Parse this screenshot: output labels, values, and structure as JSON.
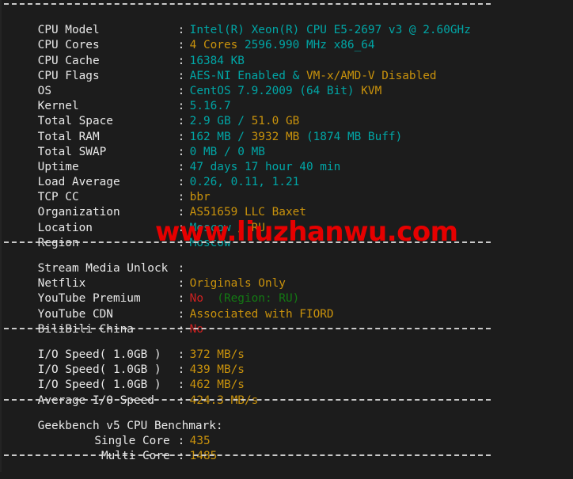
{
  "terminal": {
    "background_color": "#1c1c1c",
    "label_color": "#e8e8e8",
    "cyan_color": "#00a6a6",
    "orange_color": "#c9920c",
    "red_color": "#cf2020",
    "green_color": "#137a13",
    "separator": "--------------------------------------------------------------------"
  },
  "watermark": {
    "text": "www.liuzhanwu.com",
    "color": "#e60000"
  },
  "system_info": {
    "cpu_model": {
      "label": "CPU Model",
      "colon": ":",
      "value": "Intel(R) Xeon(R) CPU E5-2697 v3 @ 2.60GHz"
    },
    "cpu_cores": {
      "label": "CPU Cores",
      "colon": ":",
      "value_a": "4 Cores",
      "value_b": " 2596.990 MHz x86_64"
    },
    "cpu_cache": {
      "label": "CPU Cache",
      "colon": ":",
      "value": "16384 KB"
    },
    "cpu_flags": {
      "label": "CPU Flags",
      "colon": ":",
      "value_a": "AES-NI Enabled",
      "value_b": " & ",
      "value_c": "VM-x/AMD-V Disabled"
    },
    "os": {
      "label": "OS",
      "colon": ":",
      "value_a": "CentOS 7.9.2009 (64 Bit)",
      "value_b": " KVM"
    },
    "kernel": {
      "label": "Kernel",
      "colon": ":",
      "value": "5.16.7"
    },
    "total_space": {
      "label": "Total Space",
      "colon": ":",
      "value_a": "2.9 GB / ",
      "value_b": "51.0 GB"
    },
    "total_ram": {
      "label": "Total RAM",
      "colon": ":",
      "value_a": "162 MB / ",
      "value_b": "3932 MB",
      "value_c": " (1874 MB Buff)"
    },
    "total_swap": {
      "label": "Total SWAP",
      "colon": ":",
      "value": "0 MB / 0 MB"
    },
    "uptime": {
      "label": "Uptime",
      "colon": ":",
      "value": "47 days 17 hour 40 min"
    },
    "load_average": {
      "label": "Load Average",
      "colon": ":",
      "value": "0.26, 0.11, 1.21"
    },
    "tcp_cc": {
      "label": "TCP CC",
      "colon": ":",
      "value": "bbr"
    },
    "organization": {
      "label": "Organization",
      "colon": ":",
      "value": "AS51659 LLC Baxet"
    },
    "location": {
      "label": "Location",
      "colon": ":",
      "value_a": "Moscow",
      "value_b": " / RU"
    },
    "region": {
      "label": "Region",
      "colon": ":",
      "value": "Moscow"
    }
  },
  "stream_media": {
    "header": {
      "label": "Stream Media Unlock",
      "colon": ":",
      "value": ""
    },
    "netflix": {
      "label": "Netflix",
      "colon": ":",
      "value": "Originals Only"
    },
    "youtube_premium": {
      "label": "YouTube Premium",
      "colon": ":",
      "value_a": "No",
      "value_b": "  (Region: RU)"
    },
    "youtube_cdn": {
      "label": "YouTube CDN",
      "colon": ":",
      "value": "Associated with FIORD"
    },
    "bilibili_china": {
      "label": "BiliBili China",
      "colon": ":",
      "value": "No"
    }
  },
  "io_speed": {
    "test_1": {
      "label": "I/O Speed( 1.0GB )",
      "colon": ":",
      "value": "372 MB/s"
    },
    "test_2": {
      "label": "I/O Speed( 1.0GB )",
      "colon": ":",
      "value": "439 MB/s"
    },
    "test_3": {
      "label": "I/O Speed( 1.0GB )",
      "colon": ":",
      "value": "462 MB/s"
    },
    "average": {
      "label": "Average I/O Speed",
      "colon": ":",
      "value": "424.3 MB/s"
    }
  },
  "geekbench": {
    "title": "Geekbench v5 CPU Benchmark:",
    "single_core": {
      "label": "Single Core",
      "colon": ":",
      "value": "435"
    },
    "multi_core": {
      "label": "Multi Core",
      "colon": ":",
      "value": "1485"
    }
  }
}
